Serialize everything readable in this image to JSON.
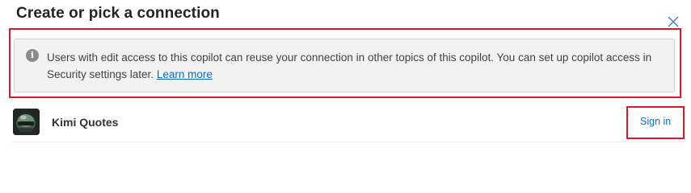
{
  "dialog": {
    "title": "Create or pick a connection",
    "close_icon": "close-icon"
  },
  "info": {
    "icon": "info-icon",
    "icon_glyph": "i",
    "message": "Users with edit access to this copilot can reuse your connection in other topics of this copilot. You can set up copilot access in Security settings later.",
    "link_label": "Learn more"
  },
  "connection": {
    "name": "Kimi Quotes",
    "avatar_icon": "helmet-avatar",
    "action_label": "Sign in"
  },
  "colors": {
    "accent": "#0f6cbd",
    "highlight": "#d9192a",
    "info_bg": "#f2f2f2"
  }
}
